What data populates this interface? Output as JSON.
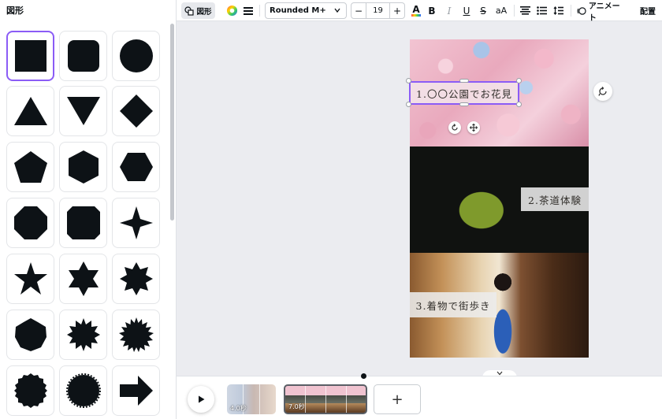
{
  "panel": {
    "title": "図形"
  },
  "shapes": [
    "square",
    "rounded-square",
    "circle",
    "triangle",
    "inverted-triangle",
    "diamond",
    "pentagon",
    "hexagon",
    "hexagon-horizontal",
    "octagon",
    "cut-corner-square",
    "four-point-star",
    "five-point-star",
    "six-point-star",
    "eight-point-star",
    "heptagon",
    "twelve-point-burst",
    "sixteen-point-burst",
    "scalloped-circle",
    "wavy-circle",
    "right-arrow"
  ],
  "toolbar": {
    "shapes_label": "図形",
    "font": "Rounded M+",
    "font_size": "19",
    "minus": "−",
    "plus": "+",
    "bold": "B",
    "italic": "I",
    "underline": "U",
    "strike": "S",
    "case": "aA",
    "animate": "アニメート",
    "position": "配置",
    "text_color_glyph": "A"
  },
  "canvas": {
    "captions": [
      "1.〇〇公園でお花見",
      "2.茶道体験",
      "3.着物で街歩き"
    ]
  },
  "timeline": {
    "clip1_duration": "4.0秒",
    "clip2_duration": "7.0秒",
    "add": "+"
  },
  "colors": {
    "accent": "#8b5cf6",
    "shape_fill": "#0d1216"
  }
}
